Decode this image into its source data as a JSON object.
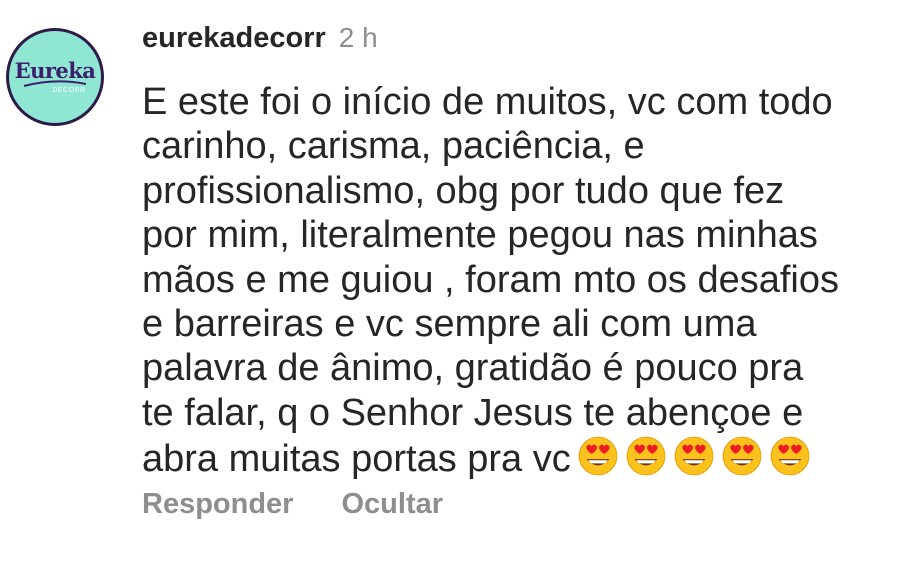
{
  "comment": {
    "avatar": {
      "logo_text": "Eureka",
      "logo_subtext": "DECORR"
    },
    "username": "eurekadecorr",
    "timestamp": "2 h",
    "text": "E este foi o início de muitos, vc com todo\ncarinho,  carisma, paciência,  e\nprofissionalismo,  obg por tudo que fez\npor mim, literalmente pegou nas minhas\nmãos e me guiou , foram mto os desafios\ne barreiras e vc sempre ali com uma\npalavra de ânimo,  gratidão é pouco pra\nte falar,  q o Senhor Jesus te abençoe e\nabra muitas portas pra vc",
    "emojis": [
      "smiling-face-with-heart-eyes",
      "smiling-face-with-heart-eyes",
      "smiling-face-with-heart-eyes",
      "smiling-face-with-heart-eyes",
      "smiling-face-with-heart-eyes"
    ],
    "actions": {
      "reply_label": "Responder",
      "hide_label": "Ocultar"
    }
  },
  "colors": {
    "text": "#262626",
    "muted": "#8e8e8e",
    "avatar_bg": "#8fe6d3",
    "avatar_ring": "#2d1a48",
    "logo": "#3b1f6b"
  }
}
